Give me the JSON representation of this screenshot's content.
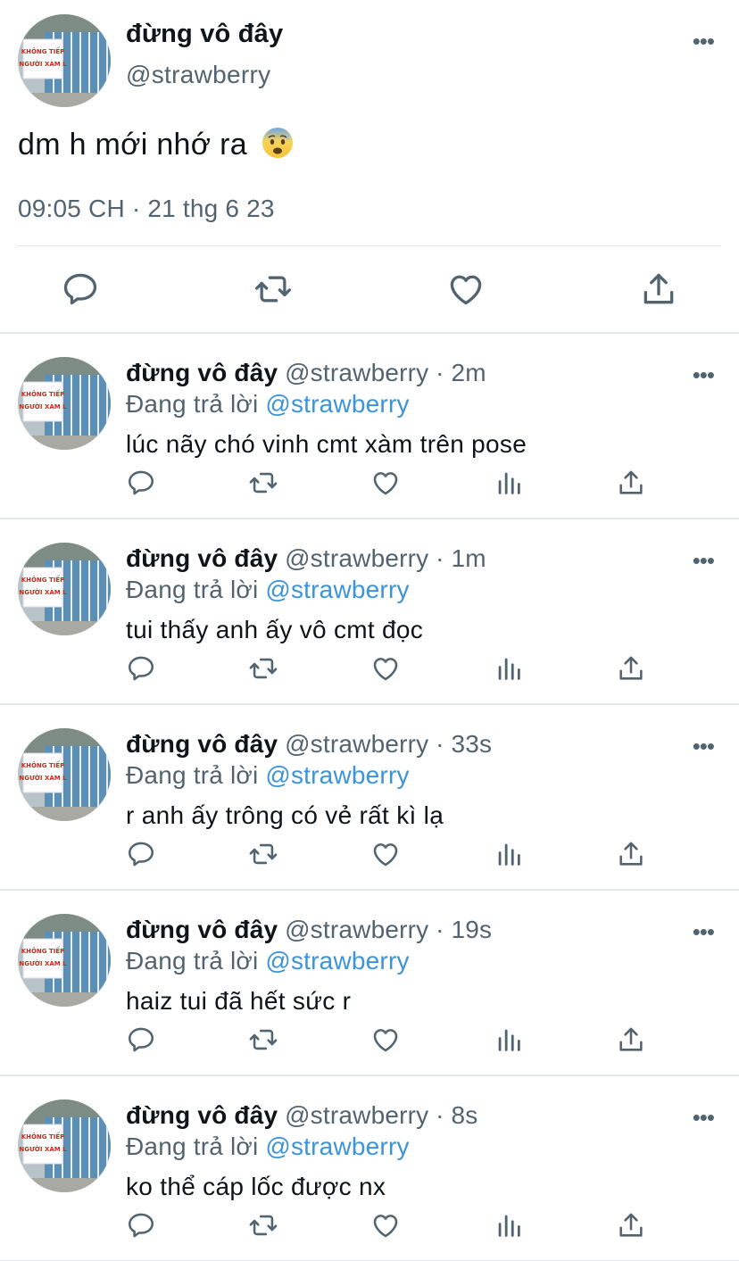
{
  "main_tweet": {
    "name": "đừng vô đây",
    "handle": "@strawberry",
    "text": "dm h mới nhớ ra",
    "emoji": "anxious-face-with-sweat-emoji",
    "timestamp": "09:05 CH · 21 thg 6 23",
    "actions": [
      "reply-icon",
      "retweet-icon",
      "like-icon",
      "share-icon"
    ]
  },
  "replies": [
    {
      "name": "đừng vô đây",
      "handle": "@strawberry",
      "dot": "·",
      "time": "2m",
      "replying_prefix": "Đang trả lời",
      "replying_to": "@strawberry",
      "text": "lúc nãy chó vinh cmt xàm trên pose"
    },
    {
      "name": "đừng vô đây",
      "handle": "@strawberry",
      "dot": "·",
      "time": "1m",
      "replying_prefix": "Đang trả lời",
      "replying_to": "@strawberry",
      "text": "tui thấy anh ấy vô cmt đọc"
    },
    {
      "name": "đừng vô đây",
      "handle": "@strawberry",
      "dot": "·",
      "time": "33s",
      "replying_prefix": "Đang trả lời",
      "replying_to": "@strawberry",
      "text": "r anh ấy trông có vẻ rất kì lạ"
    },
    {
      "name": "đừng vô đây",
      "handle": "@strawberry",
      "dot": "·",
      "time": "19s",
      "replying_prefix": "Đang trả lời",
      "replying_to": "@strawberry",
      "text": "haiz tui đã hết sức r"
    },
    {
      "name": "đừng vô đây",
      "handle": "@strawberry",
      "dot": "·",
      "time": "8s",
      "replying_prefix": "Đang trả lời",
      "replying_to": "@strawberry",
      "text": "ko thể cáp lốc được nx"
    }
  ],
  "more_glyph": "•••",
  "avatar_sign_text": [
    "KHÔNG TIẾP",
    "NGƯỜI XÀM L"
  ],
  "colors": {
    "text": "#0f1419",
    "secondary": "#536471",
    "mention": "#3b94d9",
    "divider": "#e6e9eb"
  }
}
